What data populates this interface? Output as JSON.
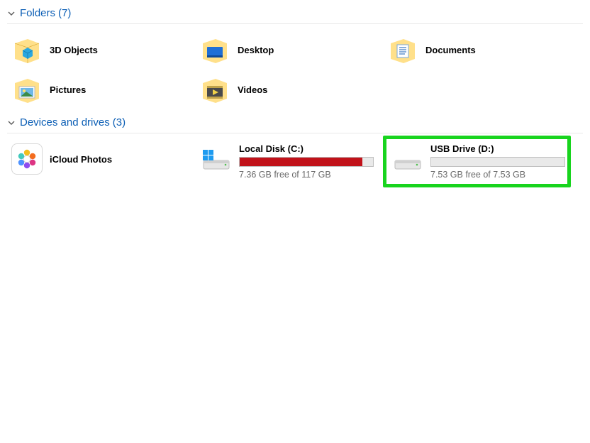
{
  "sections": {
    "folders": {
      "title": "Folders",
      "count": "(7)",
      "items": [
        {
          "label": "3D Objects"
        },
        {
          "label": "Desktop"
        },
        {
          "label": "Documents"
        },
        {
          "label": "Pictures"
        },
        {
          "label": "Videos"
        }
      ]
    },
    "drives": {
      "title": "Devices and drives",
      "count": "(3)",
      "icloud": {
        "label": "iCloud Photos"
      },
      "local": {
        "name": "Local Disk (C:)",
        "sub": "7.36 GB free of 117 GB",
        "fill_pct": 92,
        "fill_color": "#c1121a"
      },
      "usb": {
        "name": "USB Drive (D:)",
        "sub": "7.53 GB free of 7.53 GB",
        "fill_pct": 0,
        "fill_color": "#26a0da"
      }
    }
  }
}
